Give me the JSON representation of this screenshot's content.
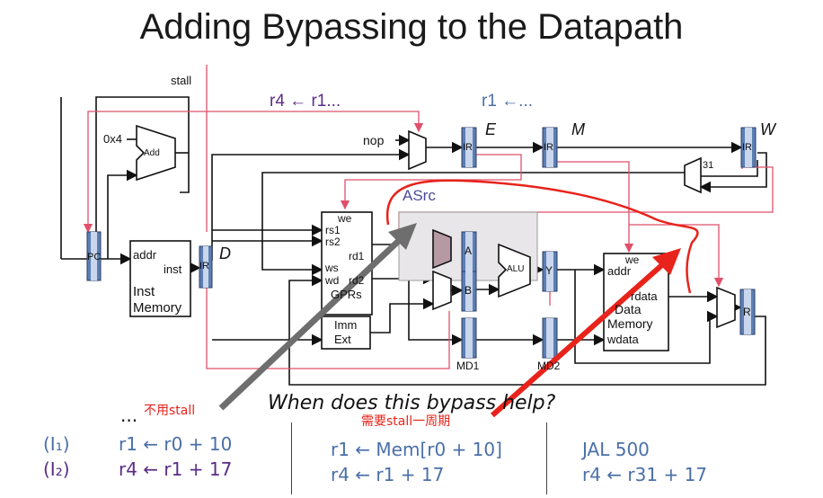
{
  "title": "Adding Bypassing to the Datapath",
  "labels": {
    "stall": "stall",
    "r4_hint": "r4 ← r1...",
    "r1_hint": "r1 ←...",
    "E": "E",
    "M": "M",
    "W": "W",
    "D": "D",
    "nop": "nop",
    "ox4": "0x4",
    "add": "Add",
    "pc": "PC",
    "addr": "addr",
    "inst": "inst",
    "inst_memory_1": "Inst",
    "inst_memory_2": "Memory",
    "ir": "IR",
    "we": "we",
    "rs1": "rs1",
    "rs2": "rs2",
    "rd1": "rd1",
    "ws": "ws",
    "wd": "wd",
    "rd2": "rd2",
    "gprs": "GPRs",
    "imm": "Imm",
    "ext": "Ext",
    "asrc": "ASrc",
    "a": "A",
    "b": "B",
    "alu": "ALU",
    "y": "Y",
    "md1": "MD1",
    "md2": "MD2",
    "dm_we": "we",
    "dm_addr": "addr",
    "dm_rdata": "rdata",
    "dm_data": "Data",
    "dm_memory": "Memory",
    "dm_wdata": "wdata",
    "r": "R",
    "n31": "31",
    "question": "When does this bypass help?"
  },
  "annotations": {
    "no_stall": "不用stall",
    "need_stall": "需要stall一周期"
  },
  "bottom": {
    "ellipsis": "...",
    "i1": "(I₁)",
    "i2": "(I₂)",
    "col1_line1": "r1 ← r0 + 10",
    "col1_line2": "r4 ← r1 + 17",
    "col2_line1": "r1 ← Mem[r0 + 10]",
    "col2_line2": "r4 ← r1 + 17",
    "col3_line1": "JAL  500",
    "col3_line2": "r4 ← r31 + 17"
  },
  "colors": {
    "register_fill": "#5b7fb5",
    "wire": "#111111",
    "bypass_wire": "#e0506a",
    "annotation_red": "#e8231b",
    "arrow_gray": "#6e6e6e",
    "hint_purple": "#5a2d86",
    "hint_blue": "#4b6fa8"
  }
}
